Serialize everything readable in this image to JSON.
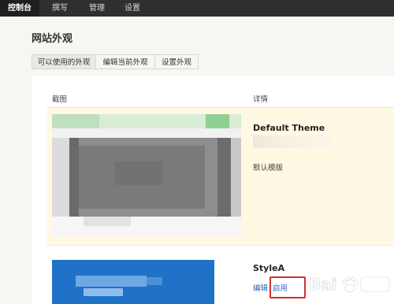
{
  "topnav": {
    "items": [
      {
        "label": "控制台",
        "active": true
      },
      {
        "label": "撰写",
        "active": false
      },
      {
        "label": "管理",
        "active": false
      },
      {
        "label": "设置",
        "active": false
      }
    ]
  },
  "page": {
    "title": "网站外观"
  },
  "tabs": [
    {
      "label": "可以使用的外观",
      "active": true
    },
    {
      "label": "编辑当前外观",
      "active": false
    },
    {
      "label": "设置外观",
      "active": false
    }
  ],
  "table": {
    "headers": {
      "screenshot": "截图",
      "details": "详情"
    },
    "themes": [
      {
        "name": "Default Theme",
        "description": "默认模版",
        "current": true
      },
      {
        "name": "StyleA",
        "actions": [
          "编辑",
          "启用"
        ]
      }
    ]
  },
  "colors": {
    "topnav_bg": "#2f2f2f",
    "current_row_bg": "#fff8e3",
    "link": "#2a62b8",
    "highlight_border": "#d0312d",
    "stylea_thumb": "#1f72c6"
  },
  "watermark": {
    "text": "Bai",
    "icon": "paw-icon"
  }
}
